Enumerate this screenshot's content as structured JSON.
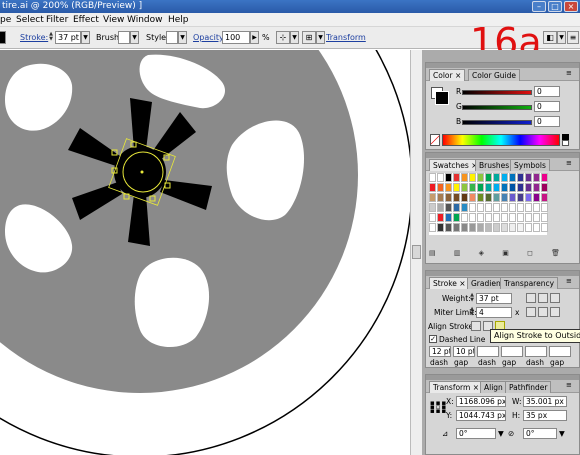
{
  "window": {
    "title": "tire.ai @ 200% (RGB/Preview) ]"
  },
  "menubar": {
    "items": [
      "pe",
      "Select",
      "Filter",
      "Effect",
      "View",
      "Window",
      "Help"
    ]
  },
  "controlbar": {
    "stroke_label": "Stroke:",
    "stroke_value": "37 pt",
    "brush_label": "Brush:",
    "style_label": "Style:",
    "opacity_label": "Opacity:",
    "opacity_value": "100",
    "opacity_unit": "%",
    "transform_label": "Transform"
  },
  "step_label": "16a",
  "color_panel": {
    "tabs": [
      "Color",
      "Color Guide"
    ],
    "channels": [
      {
        "label": "R",
        "value": "0",
        "color": "#e01010"
      },
      {
        "label": "G",
        "value": "0",
        "color": "#10b010"
      },
      {
        "label": "B",
        "value": "0",
        "color": "#1020d0"
      }
    ]
  },
  "swatches_panel": {
    "tabs": [
      "Swatches",
      "Brushes",
      "Symbols"
    ]
  },
  "stroke_panel": {
    "tabs": [
      "Stroke",
      "Gradient",
      "Transparency"
    ],
    "weight_label": "Weight:",
    "weight_value": "37 pt",
    "miter_label": "Miter Limit:",
    "miter_value": "4",
    "miter_unit": "x",
    "align_label": "Align Stroke:",
    "dashed_label": "Dashed Line",
    "dash_values": [
      "12 pt",
      "10 pt",
      "",
      "",
      "",
      ""
    ],
    "dash_labels": [
      "dash",
      "gap",
      "dash",
      "gap",
      "dash",
      "gap"
    ],
    "tooltip": "Align Stroke to Outside"
  },
  "transform_panel": {
    "tabs": [
      "Transform",
      "Align",
      "Pathfinder"
    ],
    "x_label": "X:",
    "x_value": "1168.096 px",
    "y_label": "Y:",
    "y_value": "1044.743 px",
    "w_label": "W:",
    "w_value": "35.001 px",
    "h_label": "H:",
    "h_value": "35 px",
    "rotate_value": "0°",
    "shear_value": "0°"
  }
}
